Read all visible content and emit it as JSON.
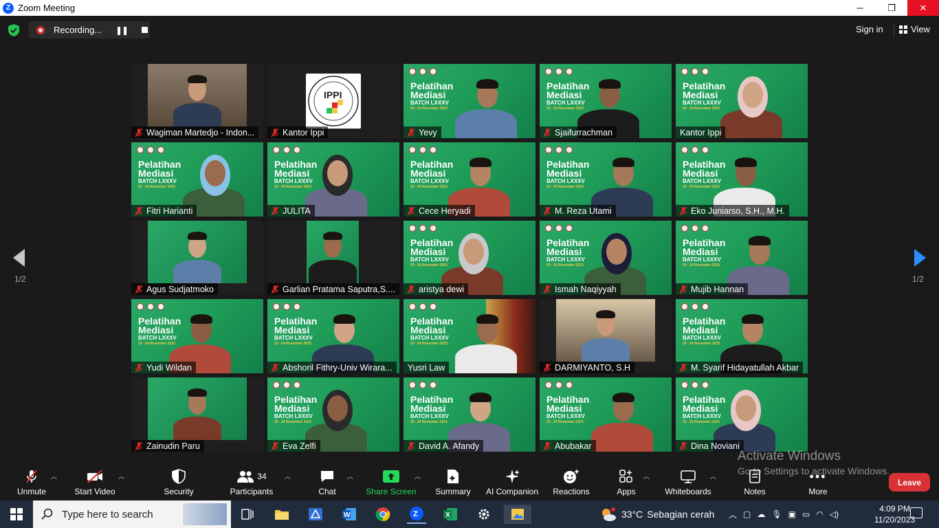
{
  "window": {
    "title": "Zoom Meeting",
    "minimize_label": "─",
    "restore_label": "❐",
    "close_label": "✕"
  },
  "topbar": {
    "recording_label": "Recording...",
    "signin_label": "Sign in",
    "view_label": "View"
  },
  "participants_grid": [
    {
      "name": "Wagiman Martedjo - Indon...",
      "muted": true
    },
    {
      "name": "Kantor Ippi",
      "muted": true
    },
    {
      "name": "Yevy",
      "muted": true
    },
    {
      "name": "Sjaifurrachman",
      "muted": true
    },
    {
      "name": "Kantor Ippi",
      "muted": false
    },
    {
      "name": "Fitri Harianti",
      "muted": true
    },
    {
      "name": "JULITA",
      "muted": true
    },
    {
      "name": "Cece Heryadi",
      "muted": true
    },
    {
      "name": "M. Reza Utami",
      "muted": true
    },
    {
      "name": "Eko Juniarso, S.H., M.H.",
      "muted": true
    },
    {
      "name": "Agus Sudjatmoko",
      "muted": true
    },
    {
      "name": "Garlian Pratama Saputra,S....",
      "muted": true
    },
    {
      "name": "aristya dewi",
      "muted": true
    },
    {
      "name": "Ismah Naqiyyah",
      "muted": true
    },
    {
      "name": "Mujib Hannan",
      "muted": true
    },
    {
      "name": "Yudi Wildan",
      "muted": true
    },
    {
      "name": "Abshoril Fithry-Univ Wirara...",
      "muted": true
    },
    {
      "name": "Yusri Law",
      "muted": false
    },
    {
      "name": "DARMIYANTO, S.H",
      "muted": true
    },
    {
      "name": "M. Syarif Hidayatullah Akbar",
      "muted": true
    },
    {
      "name": "Zainudin Paru",
      "muted": true
    },
    {
      "name": "Eva Zelfi",
      "muted": true
    },
    {
      "name": "David A. Afandy",
      "muted": true
    },
    {
      "name": "Abubakar",
      "muted": true
    },
    {
      "name": "Dina Noviani",
      "muted": true
    }
  ],
  "slide_text": {
    "line1": "Pelatihan",
    "line2": "Mediasi",
    "batch": "BATCH LXXXV",
    "dates": "20 - 24 November 2023"
  },
  "pagination": {
    "left": "1/2",
    "right": "1/2"
  },
  "toolbar": {
    "unmute": "Unmute",
    "start_video": "Start Video",
    "security": "Security",
    "participants": "Participants",
    "participants_count": "34",
    "chat": "Chat",
    "share_screen": "Share Screen",
    "summary": "Summary",
    "ai_companion": "AI Companion",
    "reactions": "Reactions",
    "apps": "Apps",
    "whiteboards": "Whiteboards",
    "notes": "Notes",
    "more": "More",
    "leave": "Leave"
  },
  "watermark": {
    "line1": "Activate Windows",
    "line2": "Go to Settings to activate Windows."
  },
  "taskbar": {
    "search_placeholder": "Type here to search",
    "weather_temp": "33°C",
    "weather_desc": "Sebagian cerah",
    "time": "4:09 PM",
    "date": "11/20/2023"
  },
  "colors": {
    "share_green": "#23d959",
    "leave_red": "#d93236",
    "slide_green": "#1f9c58"
  }
}
